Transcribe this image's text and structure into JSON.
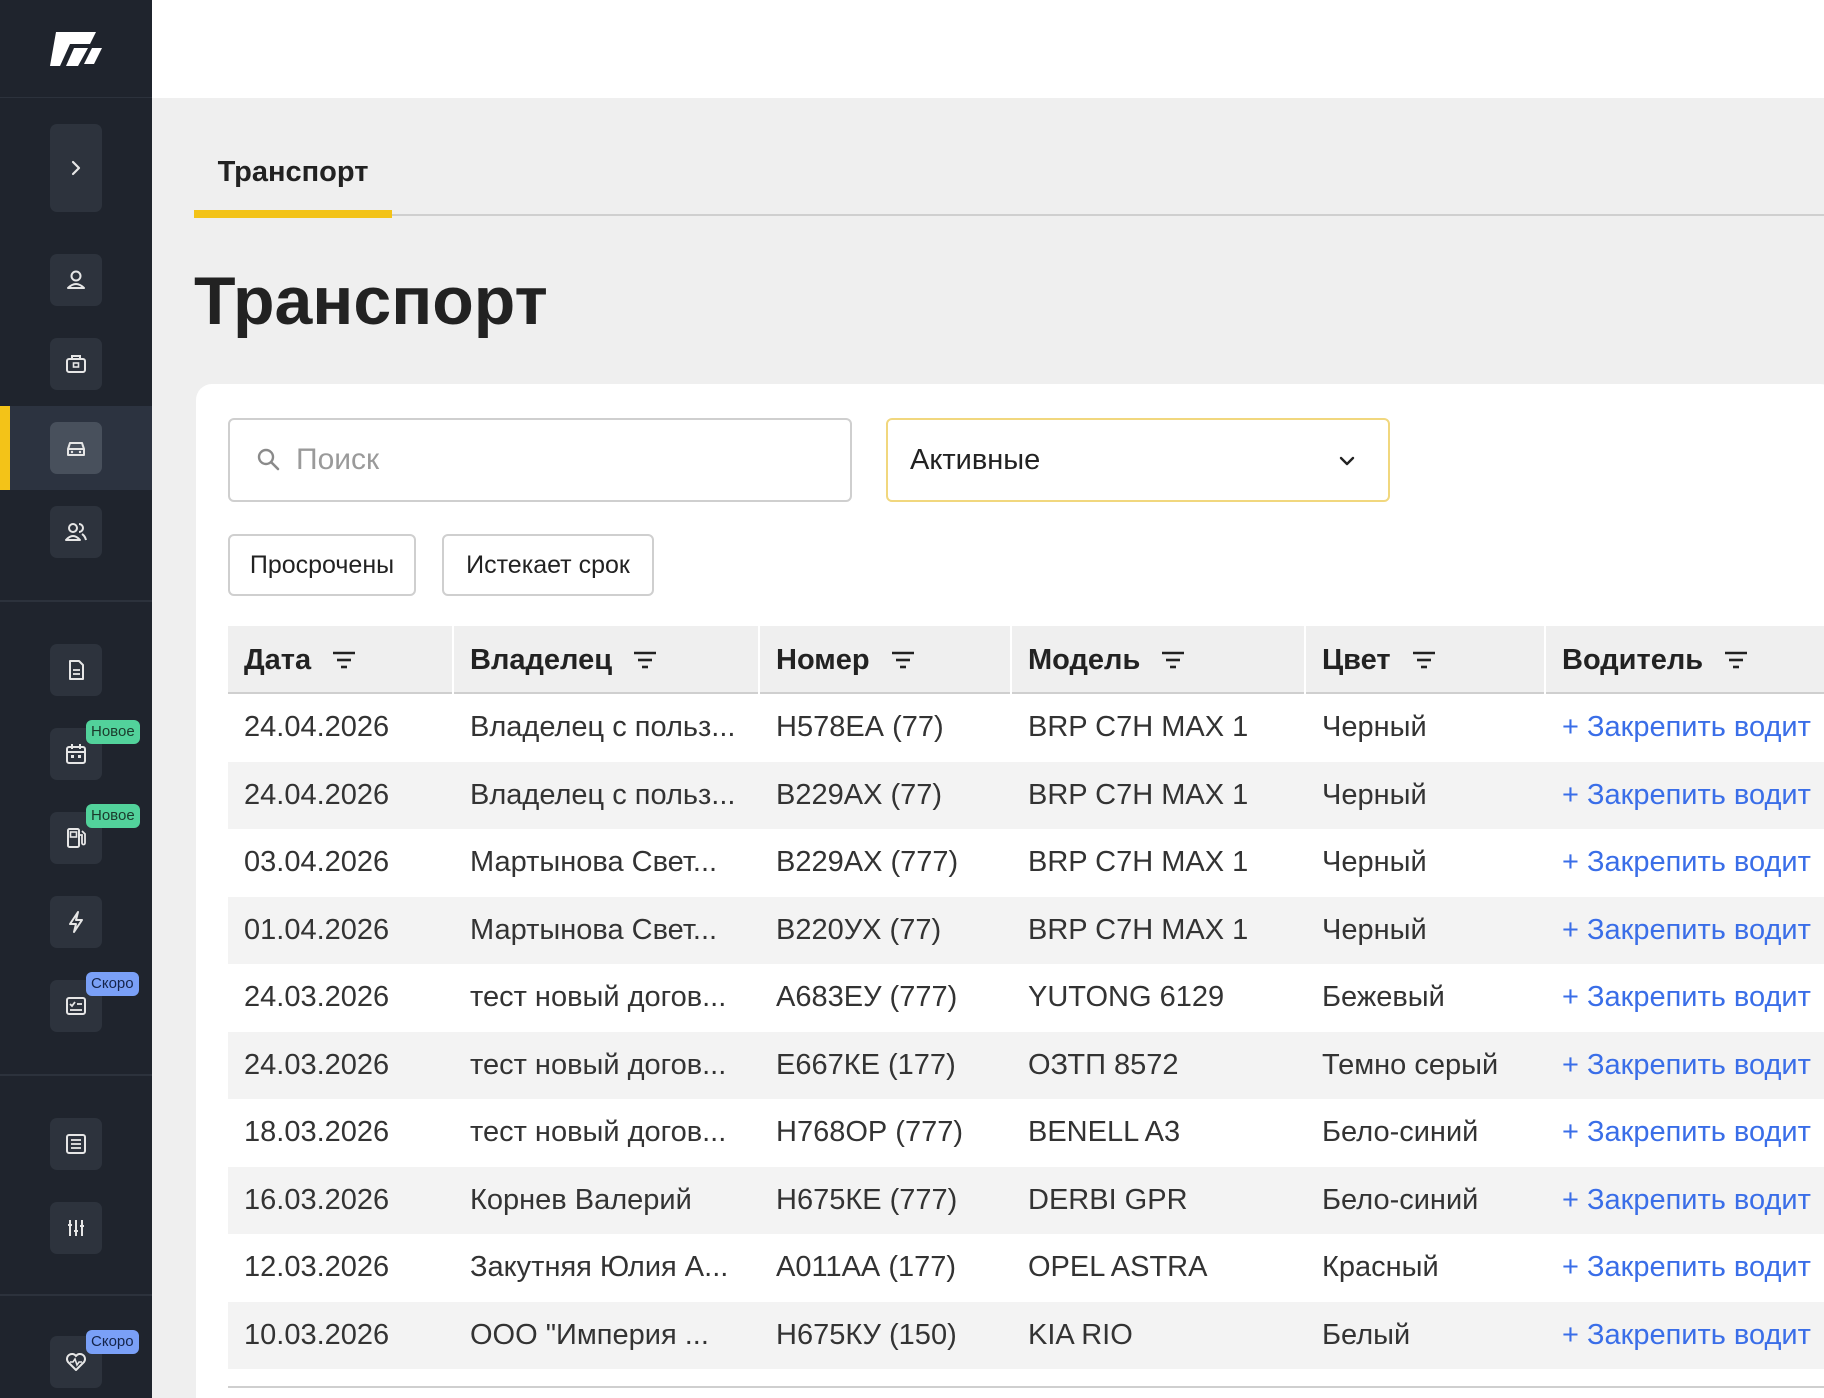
{
  "tabs": [
    {
      "label": "Транспорт"
    }
  ],
  "page_title": "Транспорт",
  "search": {
    "placeholder": "Поиск",
    "value": ""
  },
  "status_filter": {
    "value": "Активные"
  },
  "chips": [
    {
      "label": "Просрочены"
    },
    {
      "label": "Истекает срок"
    }
  ],
  "sidebar": {
    "items": [
      {
        "icon": "chevron-right-icon"
      },
      {
        "icon": "user-icon"
      },
      {
        "icon": "briefcase-icon"
      },
      {
        "icon": "car-icon",
        "active": true
      },
      {
        "icon": "users-icon"
      },
      {
        "icon": "document-icon"
      },
      {
        "icon": "calendar-icon",
        "badge": "Новое"
      },
      {
        "icon": "fuel-icon",
        "badge": "Новое"
      },
      {
        "icon": "lightning-icon"
      },
      {
        "icon": "checklist-icon",
        "badge": "Скоро"
      },
      {
        "icon": "list-icon"
      },
      {
        "icon": "sliders-icon"
      },
      {
        "icon": "heart-icon",
        "badge": "Скоро"
      }
    ]
  },
  "table": {
    "columns": [
      "Дата",
      "Владелец",
      "Номер",
      "Модель",
      "Цвет",
      "Водитель"
    ],
    "rows": [
      [
        "24.04.2026",
        "Владелец с польз...",
        "Н578ЕА (77)",
        "BRP C7H MAX 1",
        "Черный",
        "+ Закрепить водит"
      ],
      [
        "24.04.2026",
        "Владелец с польз...",
        "В229АХ (77)",
        "BRP C7H MAX 1",
        "Черный",
        "+ Закрепить водит"
      ],
      [
        "03.04.2026",
        "Мартынова Свет...",
        "В229АХ (777)",
        "BRP C7H MAX 1",
        "Черный",
        "+ Закрепить водит"
      ],
      [
        "01.04.2026",
        "Мартынова Свет...",
        "В220УХ (77)",
        "BRP C7H MAX 1",
        "Черный",
        "+ Закрепить водит"
      ],
      [
        "24.03.2026",
        "тест новый догов...",
        "А683ЕУ (777)",
        "YUTONG 6129",
        "Бежевый",
        "+ Закрепить водит"
      ],
      [
        "24.03.2026",
        "тест новый догов...",
        "Е667КЕ (177)",
        "ОЗТП 8572",
        "Темно серый",
        "+ Закрепить водит"
      ],
      [
        "18.03.2026",
        "тест новый догов...",
        "Н768ОР (777)",
        "BENELL A3",
        "Бело-синий",
        "+ Закрепить водит"
      ],
      [
        "16.03.2026",
        "Корнев Валерий",
        "Н675КЕ (777)",
        "DERBI GPR",
        "Бело-синий",
        "+ Закрепить водит"
      ],
      [
        "12.03.2026",
        "Закутняя Юлия А...",
        "А011АА (177)",
        "OPEL ASTRA",
        "Красный",
        "+ Закрепить водит"
      ],
      [
        "10.03.2026",
        "ООО \"Империя ...",
        "Н675КУ (150)",
        "KIA RIO",
        "Белый",
        "+ Закрепить водит"
      ]
    ]
  },
  "colors": {
    "accent": "#f3c318",
    "sidebar": "#1f242d",
    "link": "#3a6ee8"
  }
}
